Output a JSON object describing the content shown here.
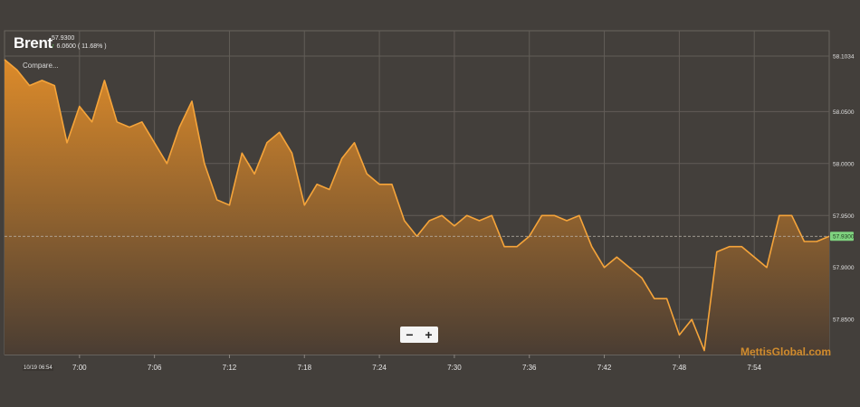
{
  "header": {
    "title": "Brent",
    "price": "57.9300",
    "change": "6.0600 ( 11.68% )",
    "compare_label": "Compare..."
  },
  "zoom": {
    "minus_label": "−",
    "plus_label": "+"
  },
  "watermark": "MettisGlobal.com",
  "start_label": "10/19 06:54",
  "colors": {
    "background": "#433f3b",
    "line": "#f5a43a",
    "fill_top": "#dd8b2a",
    "fill_bottom": "#4a3d33",
    "price_tag": "#7fd37f",
    "up_arrow": "#5fd35f"
  },
  "chart_data": {
    "type": "area",
    "title": "Brent",
    "xlabel": "",
    "ylabel": "",
    "x_ticks": [
      "7:00",
      "7:06",
      "7:12",
      "7:18",
      "7:24",
      "7:30",
      "7:36",
      "7:42",
      "7:48",
      "7:54"
    ],
    "y_ticks": [
      "57.8500",
      "57.9000",
      "57.9500",
      "58.0000",
      "58.0500",
      "58.1034"
    ],
    "ylim": [
      57.8162,
      58.1034
    ],
    "xlim": [
      "06:54",
      "08:00"
    ],
    "current_price": "57.9300",
    "grid": true,
    "x": [
      "06:54",
      "06:55",
      "06:56",
      "06:57",
      "06:58",
      "06:59",
      "07:00",
      "07:01",
      "07:02",
      "07:03",
      "07:04",
      "07:05",
      "07:06",
      "07:07",
      "07:08",
      "07:09",
      "07:10",
      "07:11",
      "07:12",
      "07:13",
      "07:14",
      "07:15",
      "07:16",
      "07:17",
      "07:18",
      "07:19",
      "07:20",
      "07:21",
      "07:22",
      "07:23",
      "07:24",
      "07:25",
      "07:26",
      "07:27",
      "07:28",
      "07:29",
      "07:30",
      "07:31",
      "07:32",
      "07:33",
      "07:34",
      "07:35",
      "07:36",
      "07:37",
      "07:38",
      "07:39",
      "07:40",
      "07:41",
      "07:42",
      "07:43",
      "07:44",
      "07:45",
      "07:46",
      "07:47",
      "07:48",
      "07:49",
      "07:50",
      "07:51",
      "07:52",
      "07:53",
      "07:54",
      "07:55",
      "07:56",
      "07:57",
      "07:58",
      "07:59",
      "08:00"
    ],
    "values": [
      58.1,
      58.09,
      58.075,
      58.08,
      58.075,
      58.02,
      58.055,
      58.04,
      58.08,
      58.04,
      58.035,
      58.04,
      58.02,
      58.0,
      58.035,
      58.06,
      58.0,
      57.965,
      57.96,
      58.01,
      57.99,
      58.02,
      58.03,
      58.01,
      57.96,
      57.98,
      57.975,
      58.005,
      58.02,
      57.99,
      57.98,
      57.98,
      57.945,
      57.93,
      57.945,
      57.95,
      57.94,
      57.95,
      57.945,
      57.95,
      57.92,
      57.92,
      57.93,
      57.95,
      57.95,
      57.945,
      57.95,
      57.92,
      57.9,
      57.91,
      57.9,
      57.89,
      57.87,
      57.87,
      57.835,
      57.85,
      57.82,
      57.915,
      57.92,
      57.92,
      57.91,
      57.9,
      57.95,
      57.95,
      57.925,
      57.925,
      57.93
    ]
  }
}
